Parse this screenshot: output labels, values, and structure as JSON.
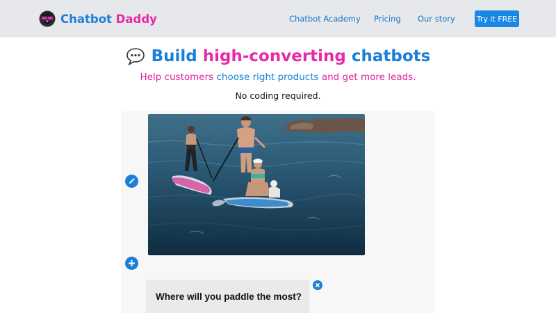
{
  "header": {
    "logo": {
      "word1": "Chatbot",
      "word2": "Daddy",
      "icon": "bearded-mascot-icon"
    },
    "nav": {
      "academy": "Chatbot Academy",
      "pricing": "Pricing",
      "story": "Our story",
      "cta": "Try it FREE"
    }
  },
  "hero": {
    "title": {
      "icon": "speech-bubble-icon",
      "part1": "Build ",
      "part2": "high-converting",
      "part3": " chatbots"
    },
    "subtitle": {
      "s1": "Help customers ",
      "s2": "choose right products",
      "s3": " and get more leads."
    },
    "note": "No coding required."
  },
  "editor": {
    "image": "paddleboarders-photo",
    "edit_icon": "pencil-icon",
    "add_icon": "plus-icon",
    "close_icon": "close-icon",
    "question": "Where will you paddle the most?"
  },
  "colors": {
    "brand_blue": "#1a7fd6",
    "brand_pink": "#e82aa6",
    "header_bg": "#e6e8ec",
    "cta_bg": "#1a87e6"
  }
}
